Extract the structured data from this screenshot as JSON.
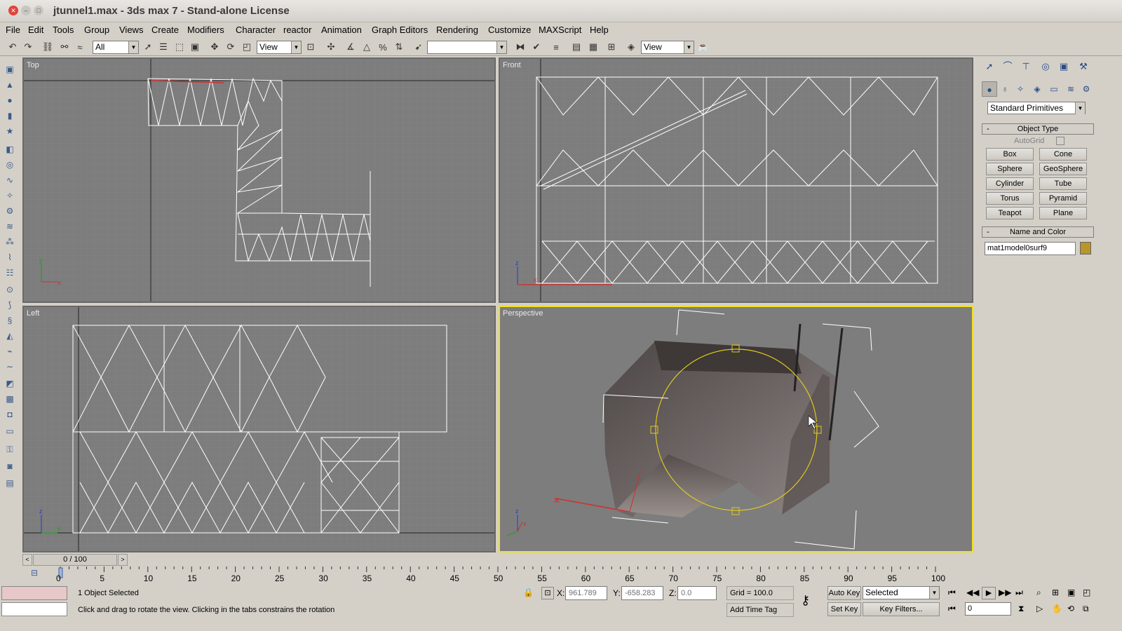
{
  "window": {
    "title": "jtunnel1.max - 3ds max 7  - Stand-alone License"
  },
  "menu": [
    "File",
    "Edit",
    "Tools",
    "Group",
    "Views",
    "Create",
    "Modifiers",
    "Character",
    "reactor",
    "Animation",
    "Graph Editors",
    "Rendering",
    "Customize",
    "MAXScript",
    "Help"
  ],
  "toolbar": {
    "selection_filter": "All",
    "ref_coord_1": "View",
    "named_selection": "",
    "ref_coord_2": "View"
  },
  "viewports": {
    "top": "Top",
    "front": "Front",
    "left": "Left",
    "perspective": "Perspective"
  },
  "command_panel": {
    "category": "Standard Primitives",
    "object_type_title": "Object Type",
    "autogrid_label": "AutoGrid",
    "buttons": [
      "Box",
      "Cone",
      "Sphere",
      "GeoSphere",
      "Cylinder",
      "Tube",
      "Torus",
      "Pyramid",
      "Teapot",
      "Plane"
    ],
    "name_color_title": "Name and Color",
    "object_name": "mat1model0surf9",
    "object_color": "#b8962a"
  },
  "time": {
    "slider_label": "0 / 100",
    "ticks": [
      "0",
      "5",
      "10",
      "15",
      "20",
      "25",
      "30",
      "35",
      "40",
      "45",
      "50",
      "55",
      "60",
      "65",
      "70",
      "75",
      "80",
      "85",
      "90",
      "95",
      "100"
    ]
  },
  "status": {
    "selection": "1 Object Selected",
    "prompt": "Click and drag to rotate the view.  Clicking in the tabs constrains the rotation",
    "x_label": "X:",
    "x": "961.789",
    "y_label": "Y:",
    "y": "-658.283",
    "z_label": "Z:",
    "z": "0.0",
    "grid": "Grid = 100.0",
    "add_time_tag": "Add Time Tag",
    "auto_key": "Auto Key",
    "set_key": "Set Key",
    "key_mode": "Selected",
    "key_filters": "Key Filters...",
    "current_frame": "0"
  },
  "colors": {
    "active_viewport": "#f0e020",
    "viewport_bg": "#7d7d7d"
  }
}
